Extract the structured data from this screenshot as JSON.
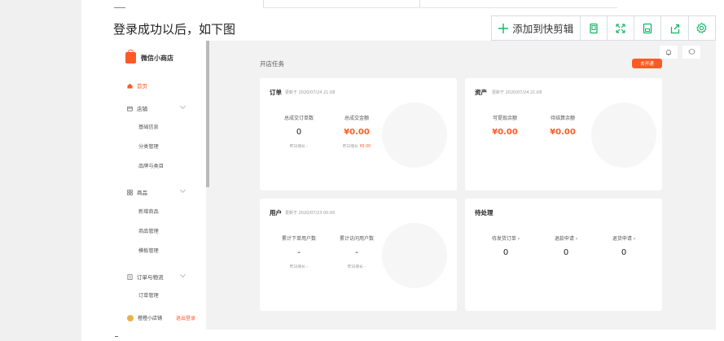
{
  "heading": "登录成功以后，如下图",
  "toolbar": {
    "add_label": "添加到快剪辑",
    "plus_color": "#18b566",
    "icon_color": "#18b566",
    "icons": [
      "plus-icon",
      "phone-icon",
      "expand-icon",
      "save-icon",
      "share-icon",
      "gear-icon"
    ]
  },
  "app": {
    "brand": "微信小商店",
    "accent": "#ff5a26",
    "nav": {
      "home": "首页",
      "shop": "店铺",
      "shop_subs": [
        "基础信息",
        "分类管理",
        "品牌与类目"
      ],
      "goods": "商品",
      "goods_subs": [
        "新增商品",
        "商品管理",
        "模板管理"
      ],
      "orders": "订单与物流",
      "order_subs": [
        "订单管理"
      ]
    },
    "user": {
      "name": "橙橙小店铺",
      "logout": "退出登录"
    },
    "main_title": "开店任务",
    "open_button": "去开通",
    "cards": {
      "orders": {
        "title": "订单",
        "updated": "更新于 2020/07/24 21:08",
        "stats": [
          {
            "label": "总成交订单数",
            "value": "0",
            "sub": "昨日增长 -",
            "sub_red": ""
          },
          {
            "label": "总成交金额",
            "value": "¥0.00",
            "sub": "昨日增长",
            "sub_red": "¥0.00"
          }
        ]
      },
      "assets": {
        "title": "资产",
        "updated": "更新于 2020/07/24 21:08",
        "stats": [
          {
            "label": "可提现余额",
            "value": "¥0.00"
          },
          {
            "label": "待结算余额",
            "value": "¥0.00"
          }
        ]
      },
      "users": {
        "title": "用户",
        "updated": "更新于 2020/07/23 00:00",
        "stats": [
          {
            "label": "累计下单用户数",
            "value": "-",
            "sub": "昨日增长 -"
          },
          {
            "label": "累计访问用户数",
            "value": "-",
            "sub": "昨日增长 -"
          }
        ]
      },
      "pending": {
        "title": "待处理",
        "stats": [
          {
            "label": "待发货订单 ›",
            "value": "0"
          },
          {
            "label": "退款申请 ›",
            "value": "0"
          },
          {
            "label": "退货申请 ›",
            "value": "0"
          }
        ]
      }
    }
  }
}
